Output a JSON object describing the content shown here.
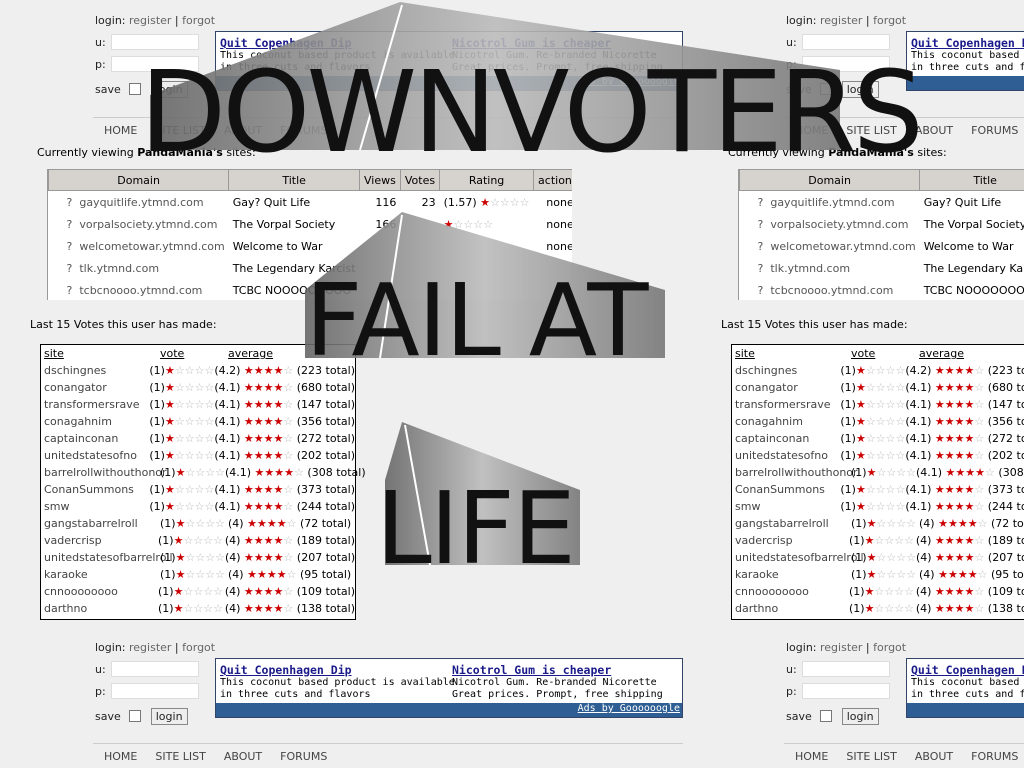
{
  "login": {
    "prefix": "login:",
    "register": "register",
    "sep": "|",
    "forgot": "forgot",
    "u_label": "u:",
    "p_label": "p:",
    "save_label": "save",
    "button": "login"
  },
  "ads": [
    {
      "title": "Quit Copenhagen Dip",
      "line1": "This coconut based product is available",
      "line2": "in three cuts and flavors"
    },
    {
      "title": "Nicotrol Gum is cheaper",
      "line1": "Nicotrol Gum. Re-branded Nicorette",
      "line2": "Great prices. Prompt, free shipping"
    }
  ],
  "ads_footer": "Ads by Goooooogle",
  "nav": [
    "HOME",
    "SITE LIST",
    "ABOUT",
    "FORUMS"
  ],
  "viewing": {
    "prefix": "Currently viewing ",
    "user": "PandaMania's",
    "suffix": " sites:"
  },
  "sites_table": {
    "headers": [
      "Domain",
      "Title",
      "Views",
      "Votes",
      "Rating",
      "actions"
    ],
    "rows": [
      {
        "domain": "gayquitlife.ytmnd.com",
        "title": "Gay? Quit Life",
        "views": "116",
        "votes": "23",
        "rating": "(1.57)",
        "rating_stars": 1,
        "action": "none!"
      },
      {
        "domain": "vorpalsociety.ytmnd.com",
        "title": "The Vorpal Society",
        "views": "166",
        "votes": "",
        "rating": "",
        "rating_stars": 1,
        "action": "none!"
      },
      {
        "domain": "welcometowar.ytmnd.com",
        "title": "Welcome to War",
        "views": "",
        "votes": "",
        "rating": "",
        "rating_stars": 0,
        "action": "none!"
      },
      {
        "domain": "tlk.ytmnd.com",
        "title": "The Legendary Karcist",
        "views": "",
        "votes": "",
        "rating": "",
        "rating_stars": 0,
        "action": ""
      },
      {
        "domain": "tcbcnoooo.ytmnd.com",
        "title": "TCBC NOOOOOOOOO",
        "views": "",
        "votes": "",
        "rating": "",
        "rating_stars": 0,
        "action": ""
      }
    ]
  },
  "votes_heading": "Last 15 Votes this user has made:",
  "votes_table": {
    "headers": [
      "site",
      "vote",
      "average"
    ],
    "rows": [
      {
        "site": "dschingnes",
        "vote": "(1)",
        "vote_stars": 1,
        "avg": "(4.2)",
        "avg_stars": 4,
        "total": "(223 total)"
      },
      {
        "site": "conangator",
        "vote": "(1)",
        "vote_stars": 1,
        "avg": "(4.1)",
        "avg_stars": 4,
        "total": "(680 total)"
      },
      {
        "site": "transformersrave",
        "vote": "(1)",
        "vote_stars": 1,
        "avg": "(4.1)",
        "avg_stars": 4,
        "total": "(147 total)"
      },
      {
        "site": "conagahnim",
        "vote": "(1)",
        "vote_stars": 1,
        "avg": "(4.1)",
        "avg_stars": 4,
        "total": "(356 total)"
      },
      {
        "site": "captainconan",
        "vote": "(1)",
        "vote_stars": 1,
        "avg": "(4.1)",
        "avg_stars": 4,
        "total": "(272 total)"
      },
      {
        "site": "unitedstatesofno",
        "vote": "(1)",
        "vote_stars": 1,
        "avg": "(4.1)",
        "avg_stars": 4,
        "total": "(202 total)"
      },
      {
        "site": "barrelrollwithouthonor",
        "vote": "(1)",
        "vote_stars": 1,
        "avg": "(4.1)",
        "avg_stars": 4,
        "total": "(308 total)"
      },
      {
        "site": "ConanSummons",
        "vote": "(1)",
        "vote_stars": 1,
        "avg": "(4.1)",
        "avg_stars": 4,
        "total": "(373 total)"
      },
      {
        "site": "smw",
        "vote": "(1)",
        "vote_stars": 1,
        "avg": "(4.1)",
        "avg_stars": 4,
        "total": "(244 total)"
      },
      {
        "site": "gangstabarrelroll",
        "vote": "(1)",
        "vote_stars": 1,
        "avg": "(4)",
        "avg_stars": 4,
        "total": "(72 total)"
      },
      {
        "site": "vadercrisp",
        "vote": "(1)",
        "vote_stars": 1,
        "avg": "(4)",
        "avg_stars": 4,
        "total": "(189 total)"
      },
      {
        "site": "unitedstatesofbarrelroll",
        "vote": "(1)",
        "vote_stars": 1,
        "avg": "(4)",
        "avg_stars": 4,
        "total": "(207 total)"
      },
      {
        "site": "karaoke",
        "vote": "(1)",
        "vote_stars": 1,
        "avg": "(4)",
        "avg_stars": 4,
        "total": "(95 total)"
      },
      {
        "site": "cnnoooooooo",
        "vote": "(1)",
        "vote_stars": 1,
        "avg": "(4)",
        "avg_stars": 4,
        "total": "(109 total)"
      },
      {
        "site": "darthno",
        "vote": "(1)",
        "vote_stars": 1,
        "avg": "(4)",
        "avg_stars": 4,
        "total": "(138 total)"
      }
    ]
  },
  "overlay": {
    "line1": "DOWNVOTERS",
    "line2": "FAIL AT",
    "line3": "LIFE"
  }
}
